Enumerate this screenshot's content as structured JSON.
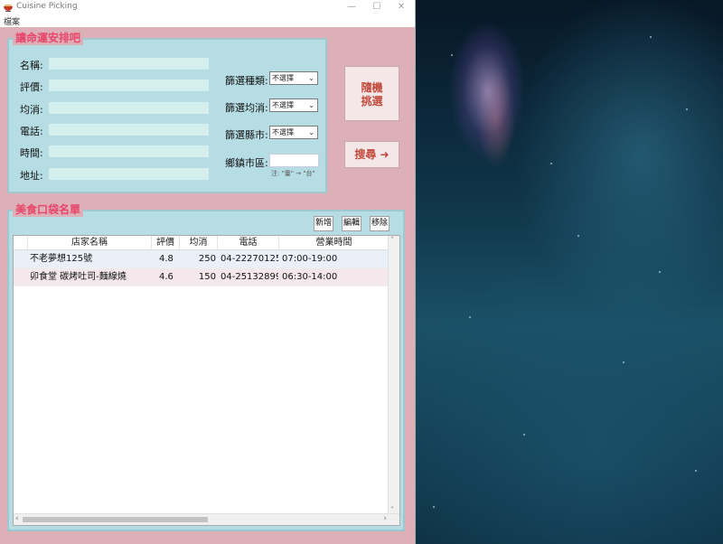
{
  "window": {
    "title": "Cuisine Picking",
    "minimize": "—",
    "maximize": "☐",
    "close": "✕"
  },
  "menu": {
    "file": "檔案"
  },
  "picker": {
    "group_title": "讓命運安排吧",
    "fields": [
      {
        "label": "名稱:"
      },
      {
        "label": "評價:"
      },
      {
        "label": "均消:"
      },
      {
        "label": "電話:"
      },
      {
        "label": "時間:"
      },
      {
        "label": "地址:"
      }
    ],
    "filters": {
      "category_label": "篩選種類:",
      "category_value": "不選擇",
      "price_label": "篩選均消:",
      "price_value": "不選擇",
      "city_label": "篩選縣市:",
      "city_value": "不選擇",
      "district_label": "鄉鎮市區:",
      "district_value": "",
      "note": "注: \"臺\" → \"台\""
    },
    "random_button": "隨機\n挑選",
    "random_line1": "隨機",
    "random_line2": "挑選",
    "search_button": "搜尋 ➜"
  },
  "list": {
    "group_title": "美食口袋名單",
    "buttons": {
      "add": "新增",
      "edit": "編輯",
      "remove": "移除"
    },
    "columns": [
      "店家名稱",
      "評價",
      "均消",
      "電話",
      "營業時間"
    ],
    "rows": [
      {
        "name": "不老夢想125號",
        "rating": "4.8",
        "price": "250",
        "phone": "04-22270125",
        "hours": "07:00-19:00",
        "extra": "5"
      },
      {
        "name": "卯食堂 碳烤吐司-麵線燒",
        "rating": "4.6",
        "price": "150",
        "phone": "04-25132899",
        "hours": "06:30-14:00",
        "extra": "5"
      }
    ]
  },
  "colors": {
    "client_bg": "#dcb0b6",
    "group_bg": "#b6dde3",
    "title_accent": "#e8456a",
    "button_text": "#c24a3a",
    "row_selected": "#eaf0f8",
    "row_alt": "#f4e8ec"
  },
  "icons": {
    "app": "bowl-icon",
    "arrow": "arrow-right-icon",
    "dropdown": "chevron-down-icon"
  }
}
